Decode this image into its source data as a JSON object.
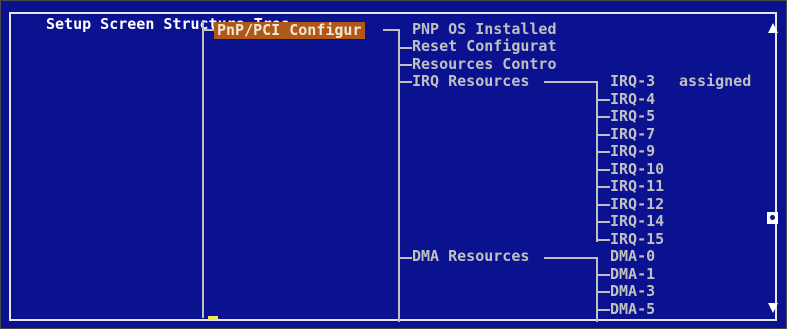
{
  "window": {
    "title": "Setup Screen Structure Tree"
  },
  "tree": {
    "root": "PnP/PCI Configur",
    "children": [
      "PNP OS Installed",
      "Reset Configurat",
      "Resources Contro",
      "IRQ Resources",
      "DMA Resources"
    ],
    "irq_assignment_label": "assigned",
    "irq_items": [
      "IRQ-3",
      "IRQ-4",
      "IRQ-5",
      "IRQ-7",
      "IRQ-9",
      "IRQ-10",
      "IRQ-11",
      "IRQ-12",
      "IRQ-14",
      "IRQ-15"
    ],
    "dma_items": [
      "DMA-0",
      "DMA-1",
      "DMA-3",
      "DMA-5"
    ]
  },
  "scrollbar": {
    "up_icon": "arrow-up-icon",
    "down_icon": "arrow-down-icon",
    "thumb": "scroll-thumb"
  },
  "colors": {
    "background": "#0b1290",
    "text": "#c0c0c0",
    "selected_bg": "#b05818",
    "frame": "#e6e6e6",
    "cursor": "#f0e850"
  }
}
